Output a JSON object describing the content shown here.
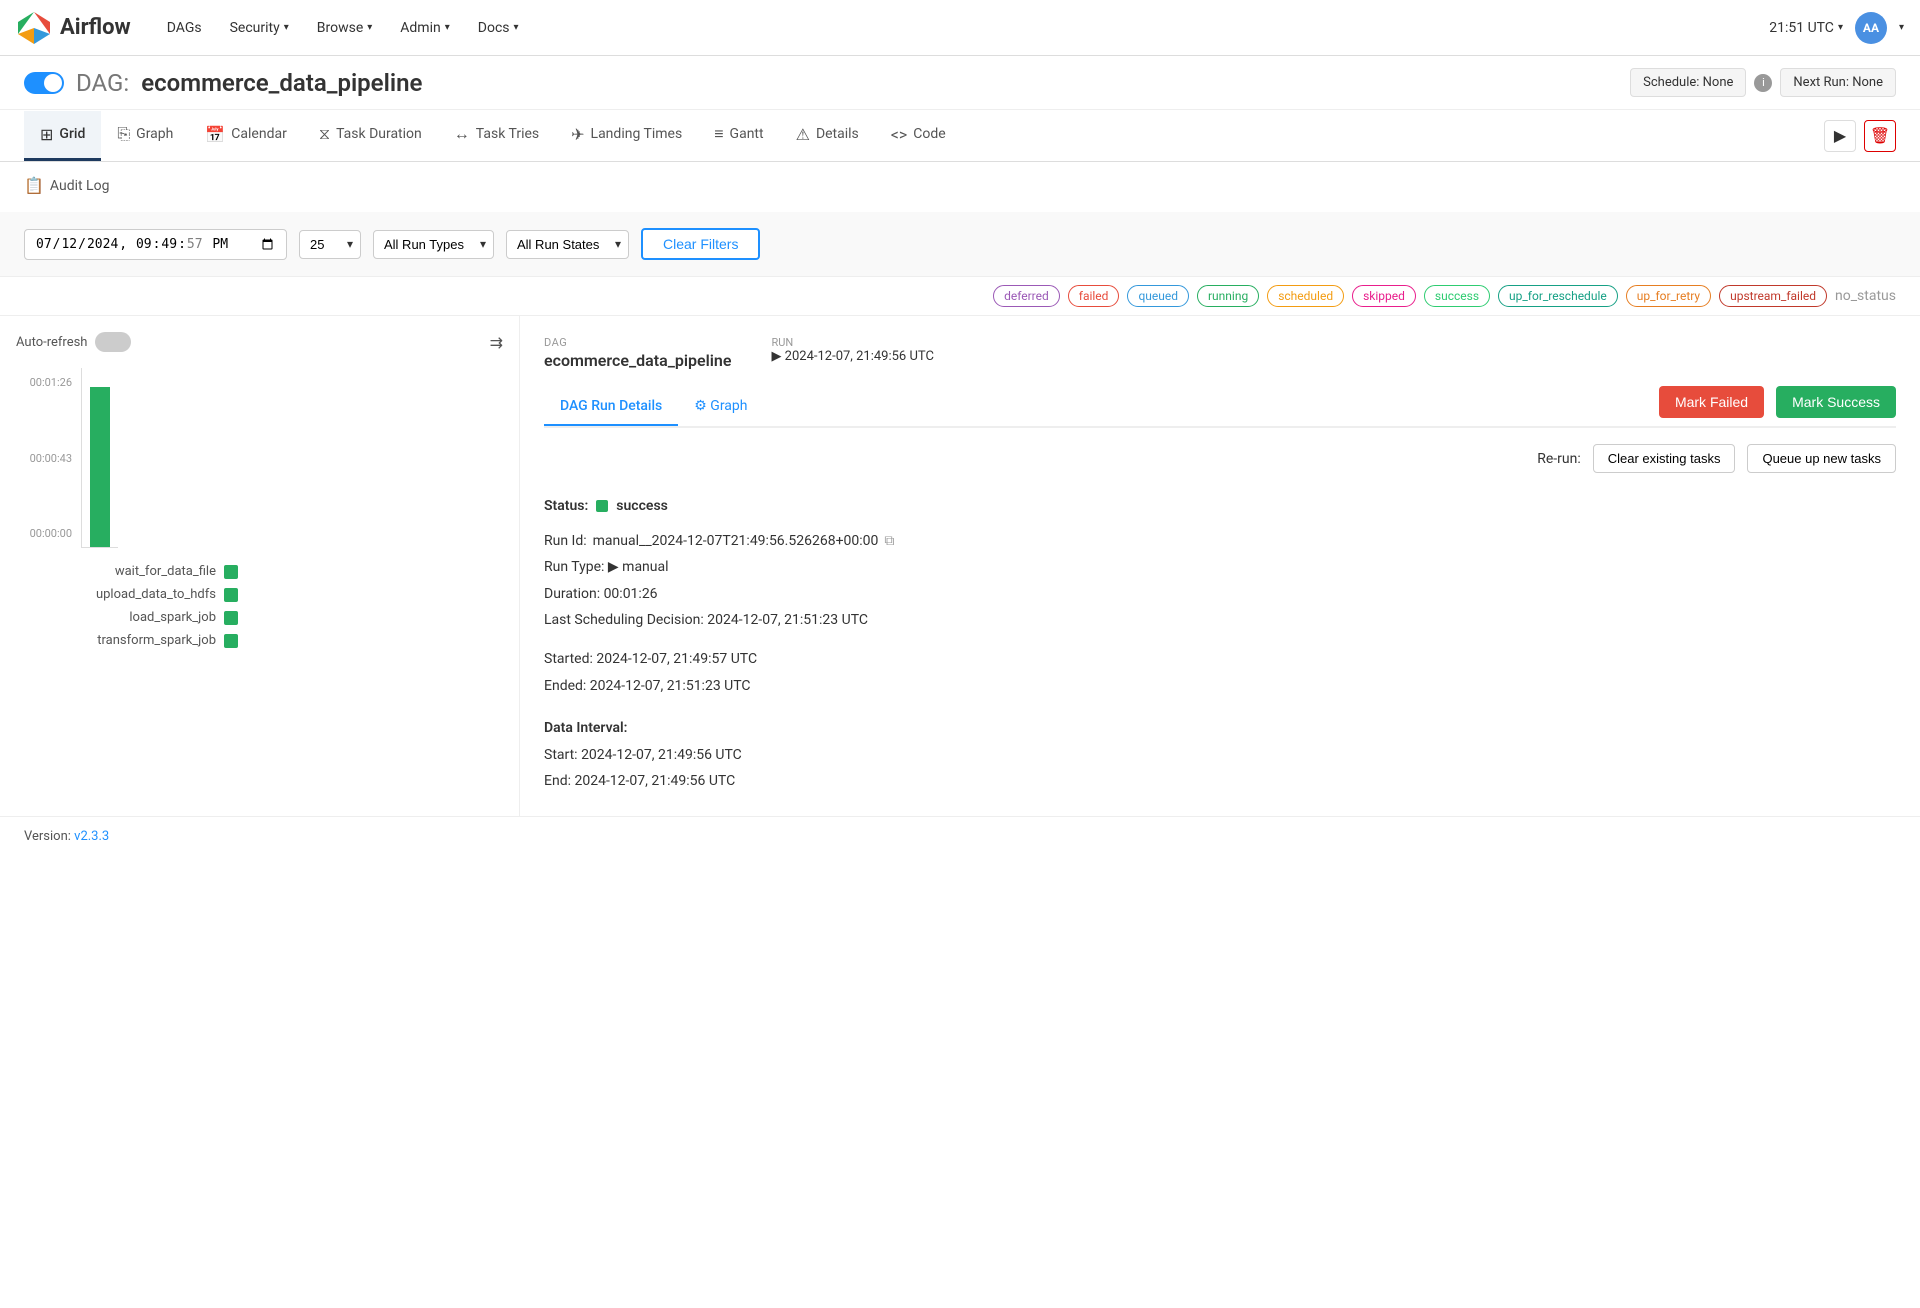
{
  "navbar": {
    "logo": "Airflow",
    "links": [
      "DAGs",
      "Security",
      "Browse",
      "Admin",
      "Docs"
    ],
    "time": "21:51 UTC",
    "avatar": "AA"
  },
  "dag": {
    "name": "ecommerce_data_pipeline",
    "schedule_label": "Schedule: None",
    "next_run_label": "Next Run: None",
    "toggle_label": "DAG:"
  },
  "tabs": {
    "items": [
      {
        "label": "Grid",
        "icon": "⊞",
        "active": true
      },
      {
        "label": "Graph",
        "icon": "⎘"
      },
      {
        "label": "Calendar",
        "icon": "📅"
      },
      {
        "label": "Task Duration",
        "icon": "⧖"
      },
      {
        "label": "Task Tries",
        "icon": "↔"
      },
      {
        "label": "Landing Times",
        "icon": "✈"
      },
      {
        "label": "Gantt",
        "icon": "≡"
      },
      {
        "label": "Details",
        "icon": "⚠"
      },
      {
        "label": "Code",
        "icon": "<>"
      },
      {
        "label": "Audit Log",
        "icon": "📋"
      }
    ]
  },
  "filters": {
    "date_value": "07/12/2024 21:49:57",
    "runs_value": "25",
    "run_types_value": "All Run Types",
    "run_states_value": "All Run States",
    "clear_label": "Clear Filters"
  },
  "legend": {
    "items": [
      {
        "label": "deferred",
        "class": "legend-deferred"
      },
      {
        "label": "failed",
        "class": "legend-failed"
      },
      {
        "label": "queued",
        "class": "legend-queued"
      },
      {
        "label": "running",
        "class": "legend-running"
      },
      {
        "label": "scheduled",
        "class": "legend-scheduled"
      },
      {
        "label": "skipped",
        "class": "legend-skipped"
      },
      {
        "label": "success",
        "class": "legend-success"
      },
      {
        "label": "up_for_reschedule",
        "class": "legend-up_for_reschedule"
      },
      {
        "label": "up_for_retry",
        "class": "legend-up_for_retry"
      },
      {
        "label": "upstream_failed",
        "class": "legend-upstream_failed"
      },
      {
        "label": "no_status",
        "class": "legend-no_status"
      }
    ]
  },
  "left_panel": {
    "auto_refresh_label": "Auto-refresh",
    "chart_labels": [
      "00:01:26",
      "00:00:43",
      "00:00:00"
    ],
    "tasks": [
      {
        "name": "wait_for_data_file"
      },
      {
        "name": "upload_data_to_hdfs"
      },
      {
        "name": "load_spark_job"
      },
      {
        "name": "transform_spark_job"
      }
    ]
  },
  "right_panel": {
    "dag_label": "DAG",
    "dag_name": "ecommerce_data_pipeline",
    "run_label": "Run",
    "run_value": "▶ 2024-12-07, 21:49:56 UTC",
    "tab_details": "DAG Run Details",
    "tab_graph": "⚙ Graph",
    "mark_failed_label": "Mark Failed",
    "mark_success_label": "Mark Success",
    "rerun_label": "Re-run:",
    "clear_tasks_label": "Clear existing tasks",
    "queue_tasks_label": "Queue up new tasks",
    "status_label": "Status:",
    "status_value": "success",
    "run_id_label": "Run Id:",
    "run_id_value": "manual__2024-12-07T21:49:56.526268+00:00",
    "run_type_label": "Run Type:",
    "run_type_value": "▶ manual",
    "duration_label": "Duration:",
    "duration_value": "00:01:26",
    "last_scheduling_label": "Last Scheduling Decision:",
    "last_scheduling_value": "2024-12-07, 21:51:23 UTC",
    "started_label": "Started:",
    "started_value": "2024-12-07, 21:49:57 UTC",
    "ended_label": "Ended:",
    "ended_value": "2024-12-07, 21:51:23 UTC",
    "data_interval_label": "Data Interval:",
    "interval_start_label": "Start:",
    "interval_start_value": "2024-12-07, 21:49:56 UTC",
    "interval_end_label": "End:",
    "interval_end_value": "2024-12-07, 21:49:56 UTC"
  },
  "footer": {
    "version_label": "Version:",
    "version_value": "v2.3.3"
  }
}
